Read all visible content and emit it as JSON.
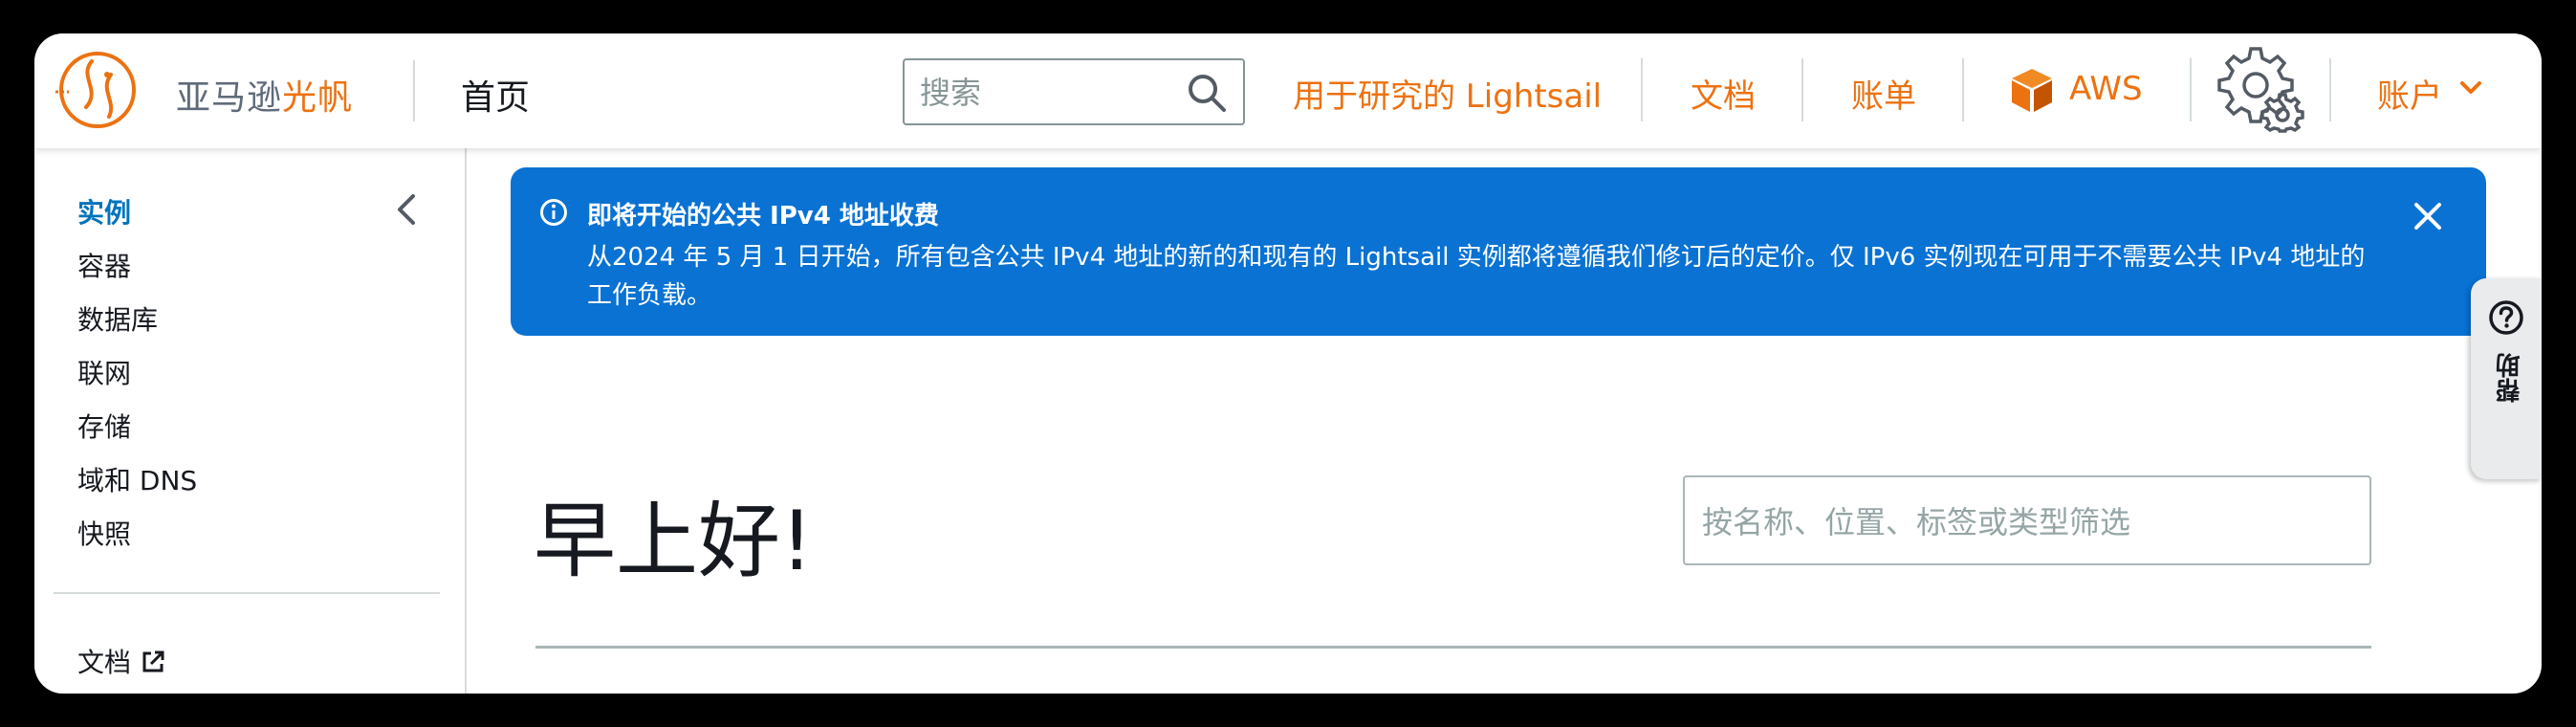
{
  "header": {
    "brand_prefix": "亚马逊",
    "brand_highlight": "光帆",
    "home": "首页",
    "search_placeholder": "搜索",
    "research": "用于研究的 Lightsail",
    "docs": "文档",
    "billing": "账单",
    "aws": "AWS",
    "account": "账户"
  },
  "sidebar": {
    "items": [
      {
        "label": "实例",
        "active": true
      },
      {
        "label": "容器"
      },
      {
        "label": "数据库"
      },
      {
        "label": "联网"
      },
      {
        "label": "存储"
      },
      {
        "label": "域和 DNS"
      },
      {
        "label": "快照"
      }
    ],
    "docs_link": "文档"
  },
  "banner": {
    "title": "即将开始的公共 IPv4 地址收费",
    "body": "从2024 年 5 月 1 日开始，所有包含公共 IPv4 地址的新的和现有的 Lightsail 实例都将遵循我们修订后的定价。仅 IPv6 实例现在可用于不需要公共 IPv4 地址的工作负载。"
  },
  "main": {
    "greeting": "早上好!",
    "filter_placeholder": "按名称、位置、标签或类型筛选"
  },
  "help_tab": "帮助",
  "colors": {
    "accent": "#ec7211",
    "link_active": "#0073bb",
    "banner_bg": "#0972d3"
  }
}
